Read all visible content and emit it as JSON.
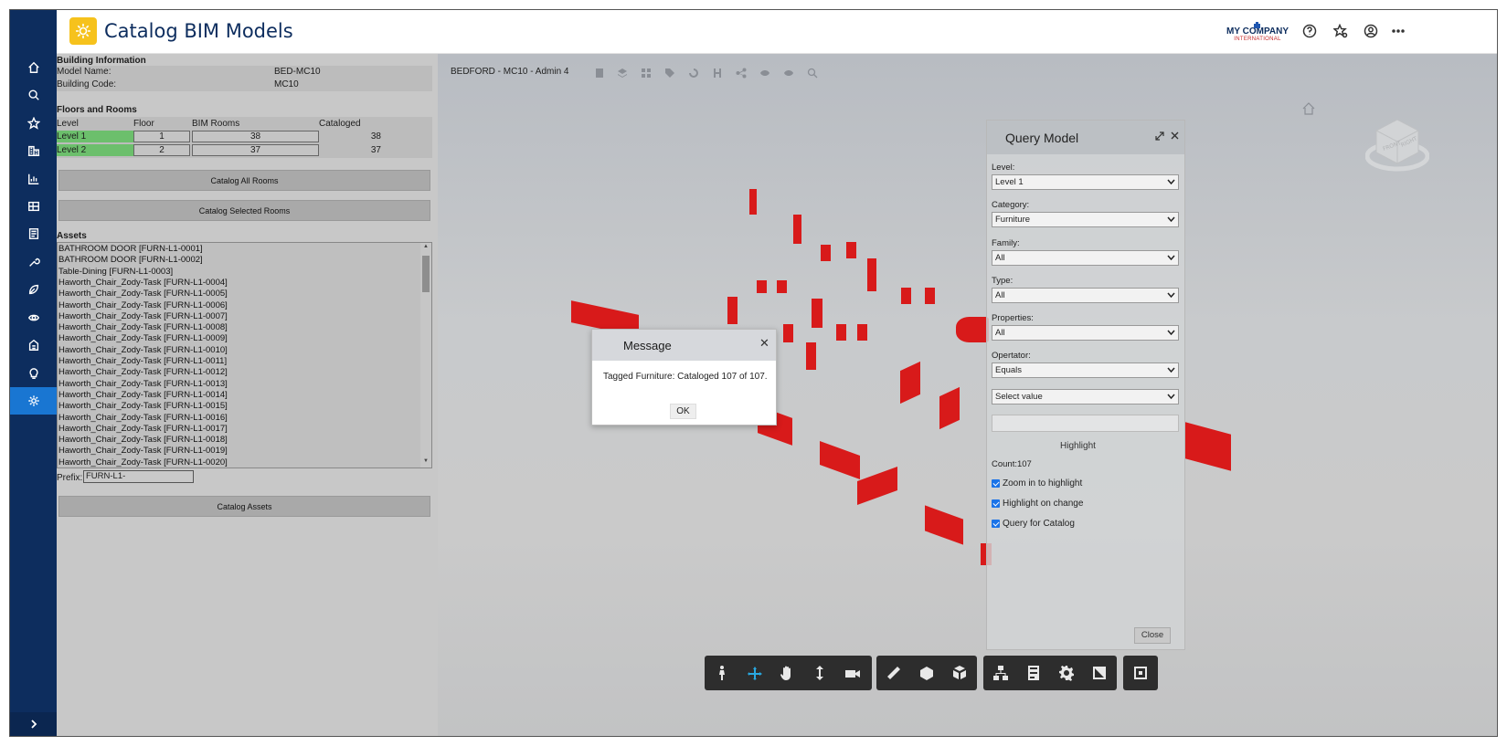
{
  "header": {
    "title": "Catalog BIM Models",
    "company_top": "MY COMPANY",
    "company_bottom": "INTERNATIONAL",
    "icons": [
      "help-icon",
      "favorites-icon",
      "user-icon",
      "more-icon"
    ]
  },
  "rail": {
    "items": [
      "home-icon",
      "search-icon",
      "star-icon",
      "buildings-icon",
      "chart-icon",
      "floorplan-icon",
      "document-icon",
      "wrench-icon",
      "leaf-icon",
      "move-icon",
      "building-box-icon",
      "lightbulb-icon",
      "gear-icon"
    ],
    "active_index": 12
  },
  "building": {
    "section_title": "Building Information",
    "model_name_label": "Model Name:",
    "model_name": "BED-MC10",
    "building_code_label": "Building Code:",
    "building_code": "MC10"
  },
  "floors": {
    "section_title": "Floors and Rooms",
    "headers": {
      "level": "Level",
      "floor": "Floor",
      "bim_rooms": "BIM Rooms",
      "cataloged": "Cataloged"
    },
    "rows": [
      {
        "level": "Level 1",
        "floor": "1",
        "bim_rooms": "38",
        "cataloged": "38"
      },
      {
        "level": "Level 2",
        "floor": "2",
        "bim_rooms": "37",
        "cataloged": "37"
      }
    ]
  },
  "buttons": {
    "catalog_all": "Catalog All Rooms",
    "catalog_selected": "Catalog Selected Rooms",
    "catalog_assets": "Catalog Assets"
  },
  "assets": {
    "section_title": "Assets",
    "items": [
      "BATHROOM DOOR [FURN-L1-0001]",
      "BATHROOM DOOR [FURN-L1-0002]",
      "Table-Dining [FURN-L1-0003]",
      "Haworth_Chair_Zody-Task [FURN-L1-0004]",
      "Haworth_Chair_Zody-Task [FURN-L1-0005]",
      "Haworth_Chair_Zody-Task [FURN-L1-0006]",
      "Haworth_Chair_Zody-Task [FURN-L1-0007]",
      "Haworth_Chair_Zody-Task [FURN-L1-0008]",
      "Haworth_Chair_Zody-Task [FURN-L1-0009]",
      "Haworth_Chair_Zody-Task [FURN-L1-0010]",
      "Haworth_Chair_Zody-Task [FURN-L1-0011]",
      "Haworth_Chair_Zody-Task [FURN-L1-0012]",
      "Haworth_Chair_Zody-Task [FURN-L1-0013]",
      "Haworth_Chair_Zody-Task [FURN-L1-0014]",
      "Haworth_Chair_Zody-Task [FURN-L1-0015]",
      "Haworth_Chair_Zody-Task [FURN-L1-0016]",
      "Haworth_Chair_Zody-Task [FURN-L1-0017]",
      "Haworth_Chair_Zody-Task [FURN-L1-0018]",
      "Haworth_Chair_Zody-Task [FURN-L1-0019]",
      "Haworth_Chair_Zody-Task [FURN-L1-0020]"
    ],
    "prefix_label": "Prefix:",
    "prefix_value": "FURN-L1-"
  },
  "viewer": {
    "title": "BEDFORD - MC10 - Admin 4",
    "toolbar_icons": [
      "building-icon",
      "layers-icon",
      "grid-icon",
      "tag-icon",
      "refresh-icon",
      "path-icon",
      "share-icon",
      "eye-icon",
      "eye-off-icon",
      "search-icon"
    ]
  },
  "query": {
    "title": "Query Model",
    "level_label": "Level:",
    "level_value": "Level 1",
    "category_label": "Category:",
    "category_value": "Furniture",
    "family_label": "Family:",
    "family_value": "All",
    "type_label": "Type:",
    "type_value": "All",
    "properties_label": "Properties:",
    "properties_value": "All",
    "operator_label": "Opertator:",
    "operator_value": "Equals",
    "value_placeholder": "Select value",
    "highlight_label": "Highlight",
    "count_text": "Count:107",
    "zoom_label": "Zoom in to highlight",
    "on_change_label": "Highlight on change",
    "catalog_label": "Query for Catalog",
    "close_label": "Close"
  },
  "dialog": {
    "title": "Message",
    "message": "Tagged Furniture: Cataloged 107 of 107.",
    "ok_label": "OK"
  },
  "bottom_toolbar": {
    "groups": [
      [
        "walk-icon",
        "orbit-icon",
        "pan-icon",
        "updown-icon",
        "camera-icon"
      ],
      [
        "measure-icon",
        "section-icon",
        "explode-icon"
      ],
      [
        "model-tree-icon",
        "properties-icon",
        "settings-icon",
        "fullscreen-icon"
      ],
      [
        "extension-icon"
      ]
    ]
  }
}
